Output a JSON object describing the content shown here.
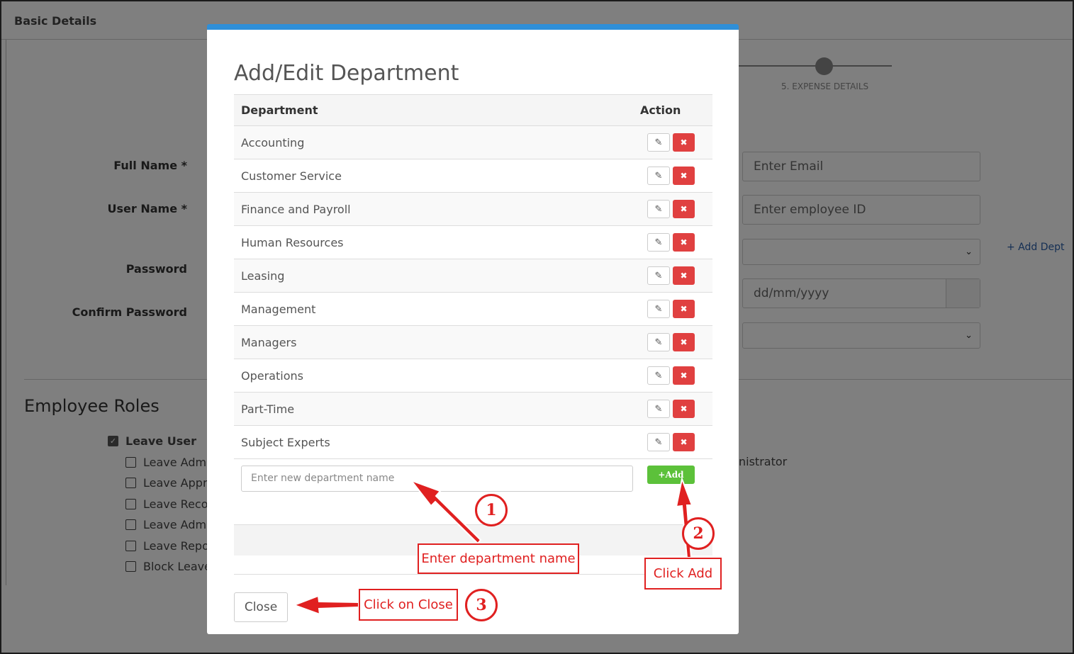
{
  "background": {
    "header_title": "Basic Details",
    "step_label": "5. EXPENSE DETAILS",
    "labels": {
      "full_name": "Full Name *",
      "user_name": "User Name *",
      "password": "Password",
      "confirm_password": "Confirm Password"
    },
    "inputs": {
      "email_placeholder": "Enter Email",
      "employee_id_placeholder": "Enter employee ID",
      "date_placeholder": "dd/mm/yyyy"
    },
    "add_dept_link": "+ Add Dept",
    "employee_roles_title": "Employee Roles",
    "roles": [
      {
        "label": "Leave User",
        "checked": true
      },
      {
        "label": "Leave Admi",
        "checked": false
      },
      {
        "label": "Leave Appro",
        "checked": false
      },
      {
        "label": "Leave Recor",
        "checked": false
      },
      {
        "label": "Leave Admi",
        "checked": false
      },
      {
        "label": "Leave Repor",
        "checked": false
      },
      {
        "label": "Block Leave",
        "checked": false
      }
    ],
    "administrator_text": "nistrator"
  },
  "modal": {
    "title": "Add/Edit Department",
    "columns": {
      "department": "Department",
      "action": "Action"
    },
    "departments": [
      "Accounting",
      "Customer Service",
      "Finance and Payroll",
      "Human Resources",
      "Leasing",
      "Management",
      "Managers",
      "Operations",
      "Part-Time",
      "Subject Experts"
    ],
    "new_dept_placeholder": "Enter new department name",
    "add_button": "+Add",
    "close_button": "Close"
  },
  "annotations": {
    "step1_text": "Enter department name",
    "step2_text": "Click Add",
    "step3_text": "Click on Close",
    "step1_num": "1",
    "step2_num": "2",
    "step3_num": "3",
    "color": "#e02020"
  },
  "colors": {
    "modal_accent": "#2f8fd8",
    "delete": "#e04040",
    "add": "#5cc13a"
  }
}
